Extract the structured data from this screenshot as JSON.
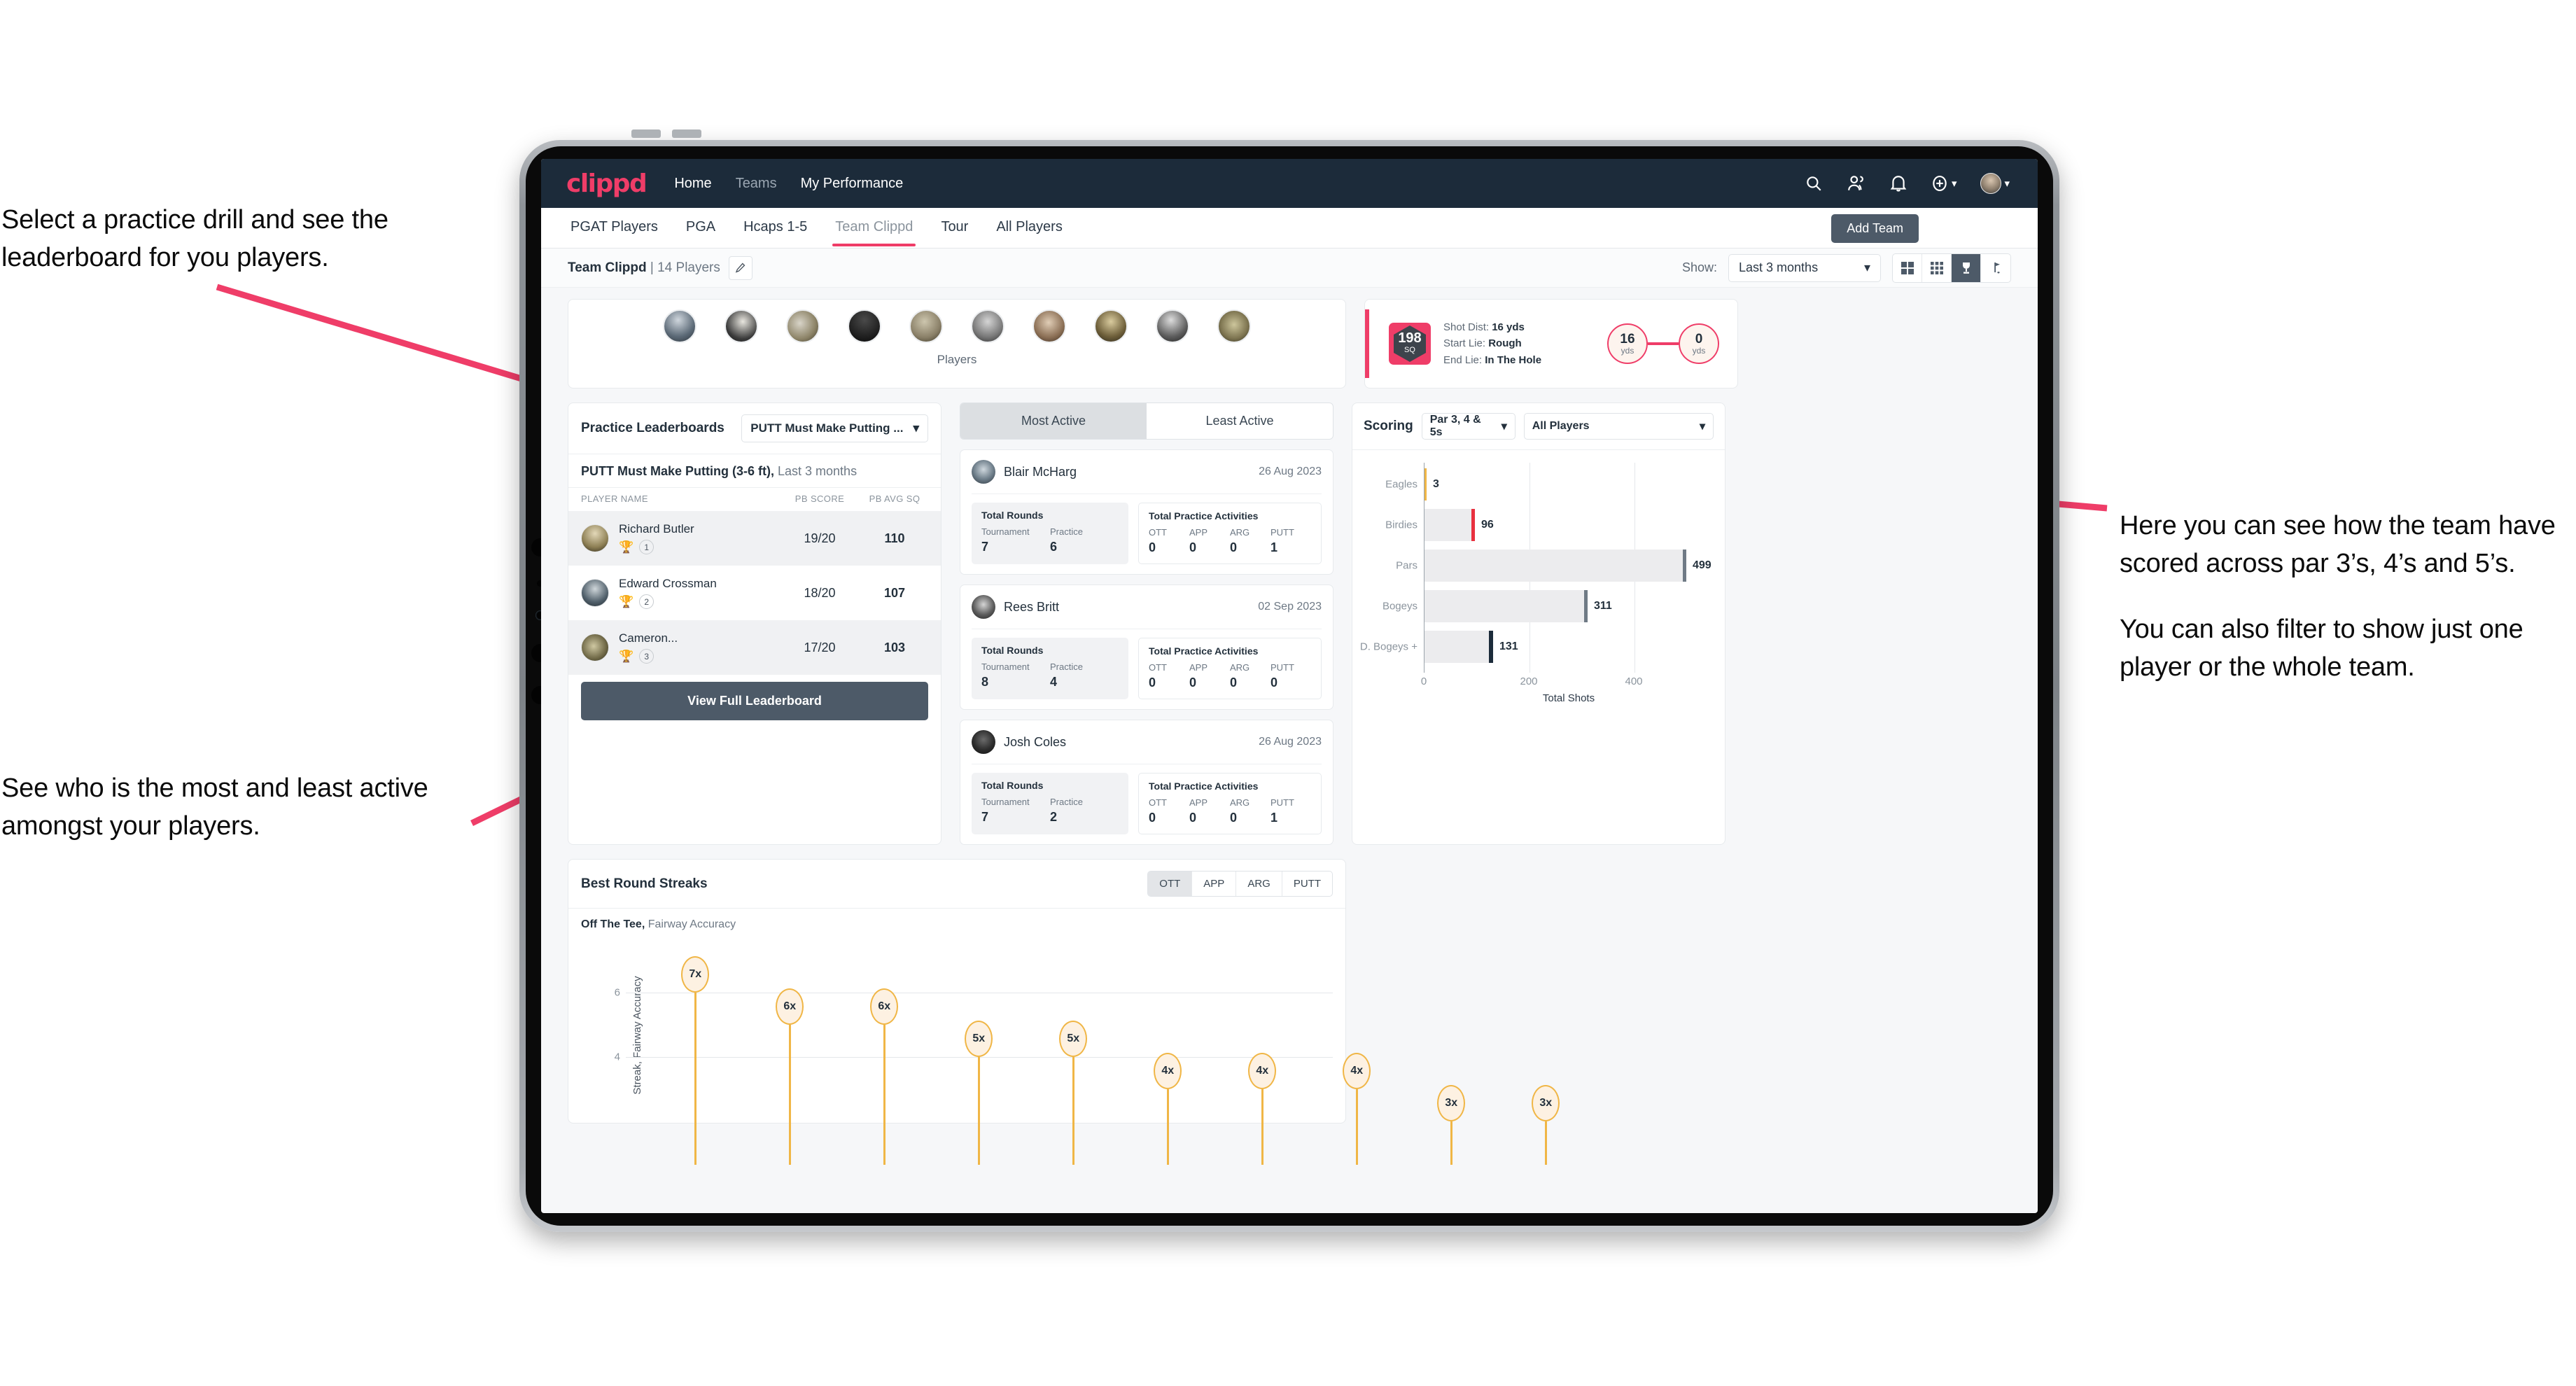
{
  "annotations": {
    "left_top": "Select a practice drill and see the leaderboard for you players.",
    "left_bottom": "See who is the most and least active amongst your players.",
    "right_p1": "Here you can see how the team have scored across par 3’s, 4’s and 5’s.",
    "right_p2": "You can also filter to show just one player or the whole team."
  },
  "topnav": {
    "logo": "clippd",
    "links": [
      {
        "label": "Home",
        "active": true
      },
      {
        "label": "Teams",
        "active": false
      },
      {
        "label": "My Performance",
        "active": true
      }
    ],
    "icons": [
      "search-icon",
      "people-icon",
      "bell-icon",
      "plus-circle-icon",
      "avatar"
    ]
  },
  "tabbar": {
    "tabs": [
      {
        "label": "PGAT Players",
        "active": false
      },
      {
        "label": "PGA",
        "active": false
      },
      {
        "label": "Hcaps 1-5",
        "active": false
      },
      {
        "label": "Team Clippd",
        "active": true
      },
      {
        "label": "Tour",
        "active": false
      },
      {
        "label": "All Players",
        "active": false
      }
    ],
    "add_team_label": "Add Team"
  },
  "subheader": {
    "team_name": "Team Clippd",
    "team_sep": " | ",
    "player_count": "14 Players",
    "edit_icon": "pencil-icon",
    "show_label": "Show:",
    "range_value": "Last 3 months",
    "view_toggles": [
      {
        "icon": "grid-large-icon",
        "active": false
      },
      {
        "icon": "grid-small-icon",
        "active": false
      },
      {
        "icon": "trophy-icon",
        "active": true
      },
      {
        "icon": "golf-flag-icon",
        "active": false
      }
    ]
  },
  "players_strip": {
    "label": "Players",
    "count": 10
  },
  "shot_card": {
    "sq_value": "198",
    "sq_unit": "SQ",
    "rows": [
      {
        "label": "Shot Dist:",
        "value": "16 yds"
      },
      {
        "label": "Start Lie:",
        "value": "Rough"
      },
      {
        "label": "End Lie:",
        "value": "In The Hole"
      }
    ],
    "start_dist": "16",
    "start_unit": "yds",
    "end_dist": "0",
    "end_unit": "yds"
  },
  "leaderboard": {
    "title": "Practice Leaderboards",
    "drill_select": "PUTT Must Make Putting ...",
    "subtitle_bold": "PUTT Must Make Putting (3-6 ft),",
    "subtitle_light": " Last 3 months",
    "columns": [
      "PLAYER NAME",
      "PB SCORE",
      "PB AVG SQ"
    ],
    "rows": [
      {
        "name": "Richard Butler",
        "rank": "1",
        "trophy": "gold",
        "score": "19/20",
        "sq": "110"
      },
      {
        "name": "Edward Crossman",
        "rank": "2",
        "trophy": "silver",
        "score": "18/20",
        "sq": "107"
      },
      {
        "name": "Cameron...",
        "rank": "3",
        "trophy": "bronze",
        "score": "17/20",
        "sq": "103"
      }
    ],
    "button": "View Full Leaderboard"
  },
  "activity": {
    "tabs": [
      {
        "label": "Most Active",
        "active": true
      },
      {
        "label": "Least Active",
        "active": false
      }
    ],
    "rounds_header": "Total Rounds",
    "practice_header": "Total Practice Activities",
    "rounds_keys": [
      "Tournament",
      "Practice"
    ],
    "practice_keys": [
      "OTT",
      "APP",
      "ARG",
      "PUTT"
    ],
    "items": [
      {
        "name": "Blair McHarg",
        "date": "26 Aug 2023",
        "tournament": "7",
        "practice": "6",
        "ott": "0",
        "app": "0",
        "arg": "0",
        "putt": "1"
      },
      {
        "name": "Rees Britt",
        "date": "02 Sep 2023",
        "tournament": "8",
        "practice": "4",
        "ott": "0",
        "app": "0",
        "arg": "0",
        "putt": "0"
      },
      {
        "name": "Josh Coles",
        "date": "26 Aug 2023",
        "tournament": "7",
        "practice": "2",
        "ott": "0",
        "app": "0",
        "arg": "0",
        "putt": "1"
      }
    ]
  },
  "scoring": {
    "title": "Scoring",
    "par_filter": "Par 3, 4 & 5s",
    "player_filter": "All Players"
  },
  "streaks": {
    "title": "Best Round Streaks",
    "tabs": [
      {
        "label": "OTT",
        "active": true
      },
      {
        "label": "APP",
        "active": false
      },
      {
        "label": "ARG",
        "active": false
      },
      {
        "label": "PUTT",
        "active": false
      }
    ],
    "subtitle_bold": "Off The Tee,",
    "subtitle_light": " Fairway Accuracy"
  },
  "chart_data": [
    {
      "type": "bar",
      "orientation": "horizontal",
      "title": "Scoring",
      "categories": [
        "Eagles",
        "Birdies",
        "Pars",
        "Bogeys",
        "D. Bogeys +"
      ],
      "values": [
        3,
        96,
        499,
        311,
        131
      ],
      "bar_colors": [
        "#f0b646",
        "#e8313f",
        "#6f7a85",
        "#6f7a85",
        "#1c2b3a"
      ],
      "xlabel": "Total Shots",
      "ylabel": "",
      "xlim": [
        0,
        540
      ],
      "xticks": [
        0,
        200,
        400
      ],
      "grid": true,
      "legend": "none"
    },
    {
      "type": "scatter",
      "subtype": "lollipop",
      "title": "Best Round Streaks",
      "series_name": "Off The Tee, Fairway Accuracy",
      "ylabel": "Streak, Fairway Accuracy",
      "yticks": [
        4,
        6
      ],
      "ylim": [
        0,
        8
      ],
      "labels": [
        "7x",
        "6x",
        "6x",
        "5x",
        "5x",
        "4x",
        "4x",
        "4x",
        "3x",
        "3x"
      ],
      "values": [
        7,
        6,
        6,
        5,
        5,
        4,
        4,
        4,
        3,
        3
      ],
      "grid": true
    }
  ]
}
